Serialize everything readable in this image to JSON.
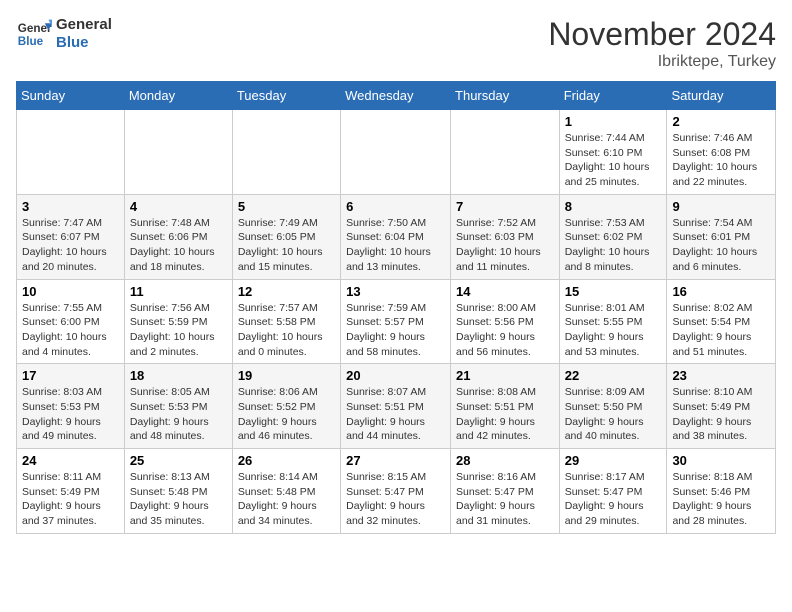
{
  "header": {
    "logo_line1": "General",
    "logo_line2": "Blue",
    "month": "November 2024",
    "location": "Ibriktepe, Turkey"
  },
  "weekdays": [
    "Sunday",
    "Monday",
    "Tuesday",
    "Wednesday",
    "Thursday",
    "Friday",
    "Saturday"
  ],
  "weeks": [
    [
      {
        "day": "",
        "info": ""
      },
      {
        "day": "",
        "info": ""
      },
      {
        "day": "",
        "info": ""
      },
      {
        "day": "",
        "info": ""
      },
      {
        "day": "",
        "info": ""
      },
      {
        "day": "1",
        "info": "Sunrise: 7:44 AM\nSunset: 6:10 PM\nDaylight: 10 hours and 25 minutes."
      },
      {
        "day": "2",
        "info": "Sunrise: 7:46 AM\nSunset: 6:08 PM\nDaylight: 10 hours and 22 minutes."
      }
    ],
    [
      {
        "day": "3",
        "info": "Sunrise: 7:47 AM\nSunset: 6:07 PM\nDaylight: 10 hours and 20 minutes."
      },
      {
        "day": "4",
        "info": "Sunrise: 7:48 AM\nSunset: 6:06 PM\nDaylight: 10 hours and 18 minutes."
      },
      {
        "day": "5",
        "info": "Sunrise: 7:49 AM\nSunset: 6:05 PM\nDaylight: 10 hours and 15 minutes."
      },
      {
        "day": "6",
        "info": "Sunrise: 7:50 AM\nSunset: 6:04 PM\nDaylight: 10 hours and 13 minutes."
      },
      {
        "day": "7",
        "info": "Sunrise: 7:52 AM\nSunset: 6:03 PM\nDaylight: 10 hours and 11 minutes."
      },
      {
        "day": "8",
        "info": "Sunrise: 7:53 AM\nSunset: 6:02 PM\nDaylight: 10 hours and 8 minutes."
      },
      {
        "day": "9",
        "info": "Sunrise: 7:54 AM\nSunset: 6:01 PM\nDaylight: 10 hours and 6 minutes."
      }
    ],
    [
      {
        "day": "10",
        "info": "Sunrise: 7:55 AM\nSunset: 6:00 PM\nDaylight: 10 hours and 4 minutes."
      },
      {
        "day": "11",
        "info": "Sunrise: 7:56 AM\nSunset: 5:59 PM\nDaylight: 10 hours and 2 minutes."
      },
      {
        "day": "12",
        "info": "Sunrise: 7:57 AM\nSunset: 5:58 PM\nDaylight: 10 hours and 0 minutes."
      },
      {
        "day": "13",
        "info": "Sunrise: 7:59 AM\nSunset: 5:57 PM\nDaylight: 9 hours and 58 minutes."
      },
      {
        "day": "14",
        "info": "Sunrise: 8:00 AM\nSunset: 5:56 PM\nDaylight: 9 hours and 56 minutes."
      },
      {
        "day": "15",
        "info": "Sunrise: 8:01 AM\nSunset: 5:55 PM\nDaylight: 9 hours and 53 minutes."
      },
      {
        "day": "16",
        "info": "Sunrise: 8:02 AM\nSunset: 5:54 PM\nDaylight: 9 hours and 51 minutes."
      }
    ],
    [
      {
        "day": "17",
        "info": "Sunrise: 8:03 AM\nSunset: 5:53 PM\nDaylight: 9 hours and 49 minutes."
      },
      {
        "day": "18",
        "info": "Sunrise: 8:05 AM\nSunset: 5:53 PM\nDaylight: 9 hours and 48 minutes."
      },
      {
        "day": "19",
        "info": "Sunrise: 8:06 AM\nSunset: 5:52 PM\nDaylight: 9 hours and 46 minutes."
      },
      {
        "day": "20",
        "info": "Sunrise: 8:07 AM\nSunset: 5:51 PM\nDaylight: 9 hours and 44 minutes."
      },
      {
        "day": "21",
        "info": "Sunrise: 8:08 AM\nSunset: 5:51 PM\nDaylight: 9 hours and 42 minutes."
      },
      {
        "day": "22",
        "info": "Sunrise: 8:09 AM\nSunset: 5:50 PM\nDaylight: 9 hours and 40 minutes."
      },
      {
        "day": "23",
        "info": "Sunrise: 8:10 AM\nSunset: 5:49 PM\nDaylight: 9 hours and 38 minutes."
      }
    ],
    [
      {
        "day": "24",
        "info": "Sunrise: 8:11 AM\nSunset: 5:49 PM\nDaylight: 9 hours and 37 minutes."
      },
      {
        "day": "25",
        "info": "Sunrise: 8:13 AM\nSunset: 5:48 PM\nDaylight: 9 hours and 35 minutes."
      },
      {
        "day": "26",
        "info": "Sunrise: 8:14 AM\nSunset: 5:48 PM\nDaylight: 9 hours and 34 minutes."
      },
      {
        "day": "27",
        "info": "Sunrise: 8:15 AM\nSunset: 5:47 PM\nDaylight: 9 hours and 32 minutes."
      },
      {
        "day": "28",
        "info": "Sunrise: 8:16 AM\nSunset: 5:47 PM\nDaylight: 9 hours and 31 minutes."
      },
      {
        "day": "29",
        "info": "Sunrise: 8:17 AM\nSunset: 5:47 PM\nDaylight: 9 hours and 29 minutes."
      },
      {
        "day": "30",
        "info": "Sunrise: 8:18 AM\nSunset: 5:46 PM\nDaylight: 9 hours and 28 minutes."
      }
    ]
  ]
}
